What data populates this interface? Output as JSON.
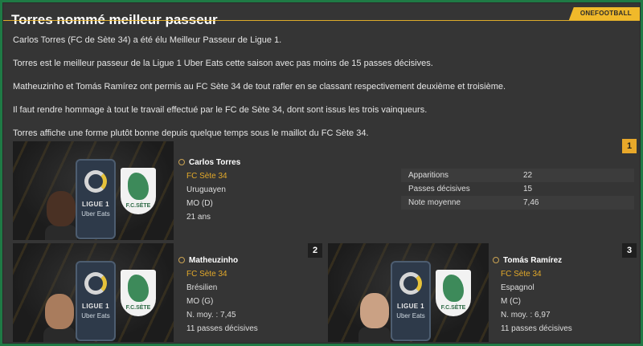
{
  "article": {
    "title": "Torres nommé meilleur passeur",
    "brand": "ONEFOOTBALL",
    "paragraphs": [
      "Carlos Torres (FC de Sète 34) a été élu Meilleur Passeur de Ligue 1.",
      "Torres est le meilleur passeur de la Ligue 1 Uber Eats cette saison avec pas moins de 15 passes décisives.",
      "Matheuzinho et Tomás Ramírez ont permis au FC Sète 34 de tout rafler en se classant respectivement deuxième et troisième.",
      "Il faut rendre hommage à tout le travail effectué par le FC de Sète 34, dont sont issus les trois vainqueurs.",
      "Torres affiche une forme plutôt bonne depuis quelque temps sous le maillot du FC Sète 34."
    ]
  },
  "league_logo": {
    "line1": "LIGUE 1",
    "line2": "Uber Eats"
  },
  "club_logo": {
    "text": "F.C.SÈTE"
  },
  "winner": {
    "rank": "1",
    "name": "Carlos Torres",
    "club": "FC Sète 34",
    "nationality": "Uruguayen",
    "position": "MO (D)",
    "age": "21 ans",
    "stats": [
      {
        "label": "Apparitions",
        "value": "22"
      },
      {
        "label": "Passes décisives",
        "value": "15"
      },
      {
        "label": "Note moyenne",
        "value": "7,46"
      }
    ]
  },
  "second": {
    "rank": "2",
    "name": "Matheuzinho",
    "club": "FC Sète 34",
    "nationality": "Brésilien",
    "position": "MO (G)",
    "rating": "N. moy. : 7,45",
    "assists": "11 passes décisives"
  },
  "third": {
    "rank": "3",
    "name": "Tomás Ramírez",
    "club": "FC Sète 34",
    "nationality": "Espagnol",
    "position": "M (C)",
    "rating": "N. moy. : 6,97",
    "assists": "11 passes décisives"
  },
  "colors": {
    "accent": "#e8a82a",
    "panel": "#353535",
    "border": "#1f7a45"
  }
}
